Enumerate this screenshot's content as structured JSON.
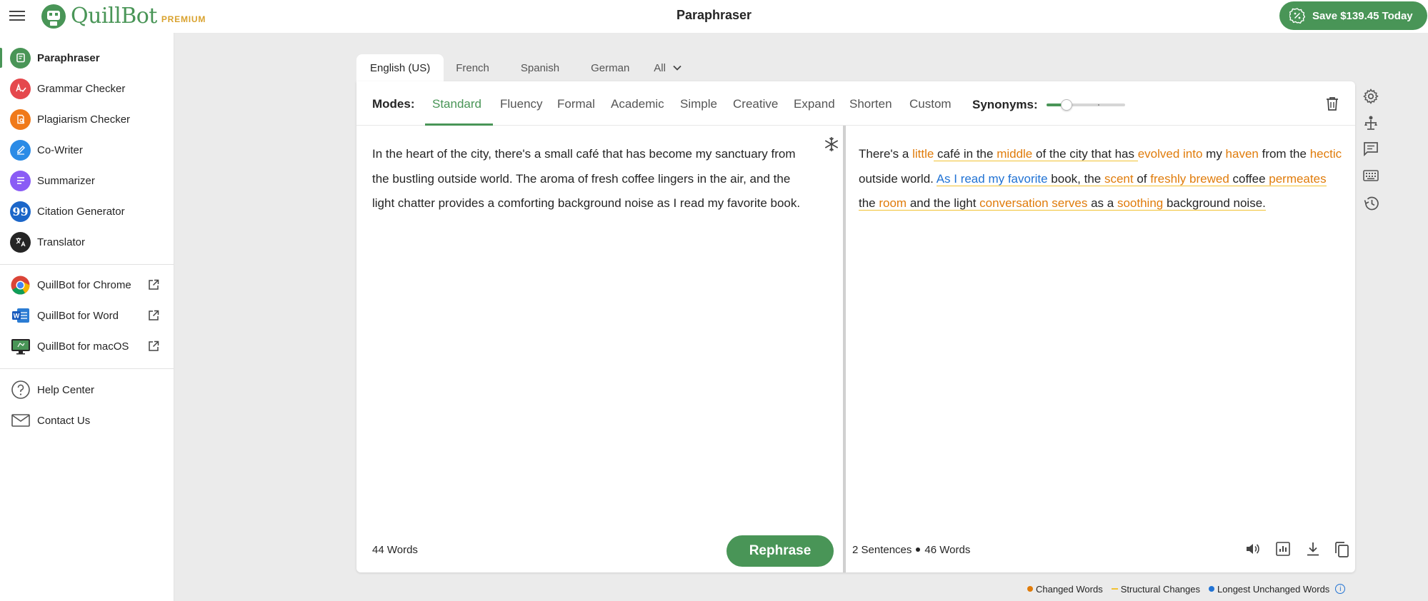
{
  "app": {
    "title": "Paraphraser",
    "logo_text": "QuillBot",
    "premium_label": "PREMIUM",
    "save_button": "Save $139.45 Today",
    "accent_color": "#499557"
  },
  "sidebar": {
    "items": [
      {
        "label": "Paraphraser",
        "icon": "paraphraser-icon",
        "color": "#499557",
        "active": true
      },
      {
        "label": "Grammar Checker",
        "icon": "grammar-checker-icon",
        "color": "#e5484d"
      },
      {
        "label": "Plagiarism Checker",
        "icon": "plagiarism-checker-icon",
        "color": "#f07a1a"
      },
      {
        "label": "Co-Writer",
        "icon": "co-writer-icon",
        "color": "#2b8be6"
      },
      {
        "label": "Summarizer",
        "icon": "summarizer-icon",
        "color": "#8a5cf5"
      },
      {
        "label": "Citation Generator",
        "icon": "citation-generator-icon",
        "color": "#1b66c9"
      },
      {
        "label": "Translator",
        "icon": "translator-icon",
        "color": "#252525"
      }
    ],
    "extensions": [
      {
        "label": "QuillBot for Chrome",
        "icon": "chrome-icon"
      },
      {
        "label": "QuillBot for Word",
        "icon": "word-icon"
      },
      {
        "label": "QuillBot for macOS",
        "icon": "macos-icon"
      }
    ],
    "support": [
      {
        "label": "Help Center",
        "icon": "help-icon"
      },
      {
        "label": "Contact Us",
        "icon": "mail-icon"
      }
    ]
  },
  "languages": [
    "English (US)",
    "French",
    "Spanish",
    "German",
    "All"
  ],
  "modes": {
    "label": "Modes:",
    "items": [
      "Standard",
      "Fluency",
      "Formal",
      "Academic",
      "Simple",
      "Creative",
      "Expand",
      "Shorten",
      "Custom"
    ],
    "active": "Standard"
  },
  "synonyms": {
    "label": "Synonyms:",
    "level": 0.25
  },
  "input": {
    "text": "In the heart of the city, there's a small café that has become my sanctuary from the bustling outside world. The aroma of fresh coffee lingers in the air, and the light chatter provides a comforting background noise as I read my favorite book.",
    "word_count": "44 Words",
    "rephrase_button": "Rephrase"
  },
  "output": {
    "segments": [
      {
        "t": "There's a ",
        "s": "",
        "u": false
      },
      {
        "t": "little",
        "s": "chg",
        "u": false
      },
      {
        "t": " café in the ",
        "s": "",
        "u": true
      },
      {
        "t": "middle",
        "s": "chg",
        "u": true
      },
      {
        "t": " of the city that has ",
        "s": "",
        "u": true
      },
      {
        "t": "evolved into",
        "s": "chg",
        "u": false
      },
      {
        "t": " my ",
        "s": "",
        "u": false
      },
      {
        "t": "haven",
        "s": "chg",
        "u": false
      },
      {
        "t": " from the ",
        "s": "",
        "u": false
      },
      {
        "t": "hectic",
        "s": "chg",
        "u": false
      },
      {
        "t": " outside world. ",
        "s": "",
        "u": false
      },
      {
        "t": "As I read my favorite",
        "s": "lng",
        "u": true
      },
      {
        "t": " book, the ",
        "s": "",
        "u": true
      },
      {
        "t": "scent",
        "s": "chg",
        "u": true
      },
      {
        "t": " of ",
        "s": "",
        "u": true
      },
      {
        "t": "freshly brewed",
        "s": "chg",
        "u": true
      },
      {
        "t": " coffee ",
        "s": "",
        "u": true
      },
      {
        "t": "permeates",
        "s": "chg",
        "u": true
      },
      {
        "t": " the ",
        "s": "",
        "u": true
      },
      {
        "t": "room",
        "s": "chg",
        "u": true
      },
      {
        "t": " and the light ",
        "s": "",
        "u": true
      },
      {
        "t": "conversation serves",
        "s": "chg",
        "u": true
      },
      {
        "t": " as a ",
        "s": "",
        "u": true
      },
      {
        "t": "soothing",
        "s": "chg",
        "u": true
      },
      {
        "t": " background noise.",
        "s": "",
        "u": true
      }
    ],
    "sentences": "2 Sentences",
    "word_count": "46 Words"
  },
  "legend": [
    {
      "label": "Changed Words",
      "color": "#e07c0b"
    },
    {
      "label": "Structural Changes",
      "color": "#f2c233"
    },
    {
      "label": "Longest Unchanged Words",
      "color": "#2173d4"
    }
  ],
  "right_rail_icons": [
    "settings-icon",
    "statistics-icon",
    "feedback-icon",
    "keyboard-icon",
    "history-icon"
  ]
}
